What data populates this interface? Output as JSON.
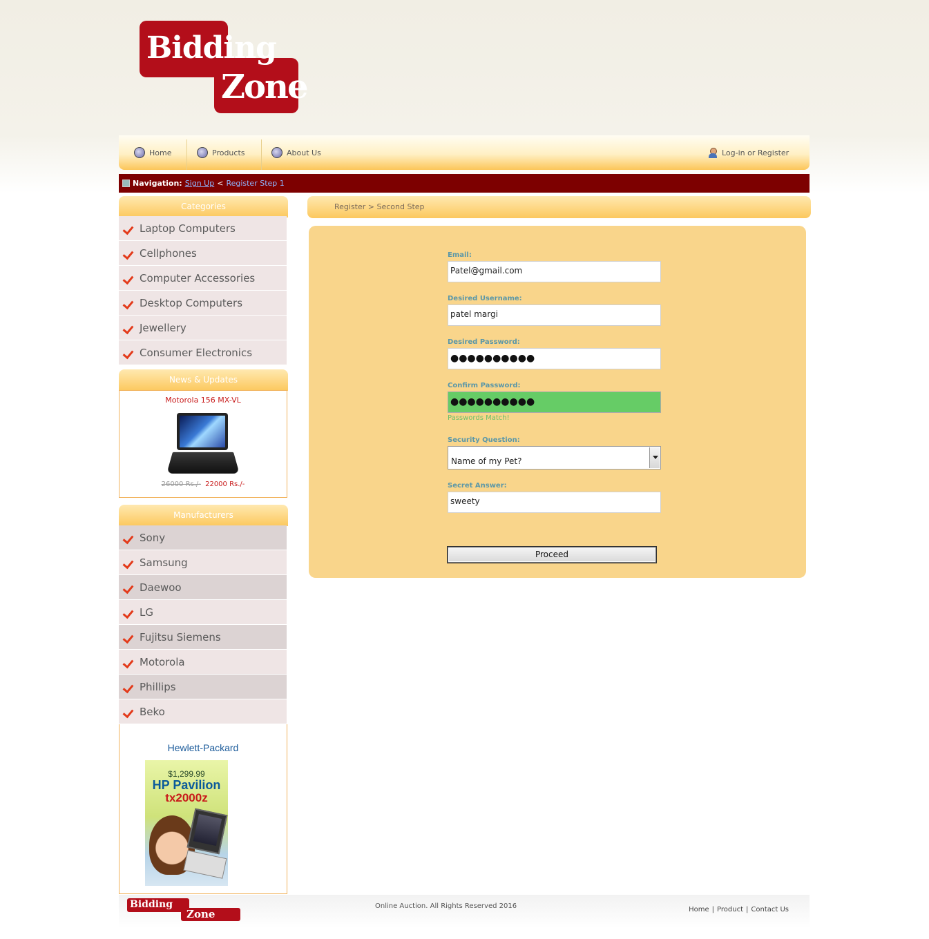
{
  "brand": {
    "logo_line1": "Bidding",
    "logo_line2": "Zone"
  },
  "nav": {
    "items": [
      {
        "label": "Home",
        "icon": "gear-icon"
      },
      {
        "label": "Products",
        "icon": "gear-icon"
      },
      {
        "label": "About Us",
        "icon": "gear-icon"
      }
    ],
    "login_label": "Log-in or Register",
    "login_icon": "user-icon"
  },
  "breadcrumb": {
    "label": "Navigation:",
    "link": "Sign Up",
    "separator": "<",
    "current": "Register Step 1"
  },
  "sidebar": {
    "categories_title": "Categories",
    "categories": [
      "Laptop Computers",
      "Cellphones",
      "Computer Accessories",
      "Desktop Computers",
      "Jewellery",
      "Consumer Electronics"
    ],
    "news_title": "News & Updates",
    "news": {
      "product": "Motorola 156 MX-VL",
      "old_price": "26000 Rs./-",
      "new_price": "22000 Rs./-"
    },
    "manufacturers_title": "Manufacturers",
    "manufacturers": [
      "Sony",
      "Samsung",
      "Daewoo",
      "LG",
      "Fujitsu Siemens",
      "Motorola",
      "Phillips",
      "Beko"
    ],
    "ad": {
      "title": "Hewlett-Packard",
      "price": "$1,299.99",
      "name_line1": "HP Pavilion",
      "name_line2": "tx2000z"
    }
  },
  "main": {
    "heading": "Register > Second Step",
    "form": {
      "email_label": "Email:",
      "email_value": "Patel@gmail.com",
      "username_label": "Desired Username:",
      "username_value": "patel margi",
      "password_label": "Desired Password:",
      "password_value": "●●●●●●●●●●",
      "confirm_label": "Confirm Password:",
      "confirm_value": "●●●●●●●●●●",
      "match_message": "Passwords Match!",
      "question_label": "Security Question:",
      "question_value": "Name of my Pet?",
      "answer_label": "Secret Answer:",
      "answer_value": "sweety",
      "submit_label": "Proceed"
    }
  },
  "footer": {
    "copyright": "Online Auction. All Rights Reserved 2016",
    "links": [
      "Home",
      "Product",
      "Contact Us"
    ],
    "link_separator": "|"
  },
  "colors": {
    "brand_red": "#b30e1a",
    "nav_gold": "#fcc65a",
    "breadcrumb_bg": "#7d0000",
    "form_bg": "#f9d58b",
    "match_green": "#66cc66"
  }
}
